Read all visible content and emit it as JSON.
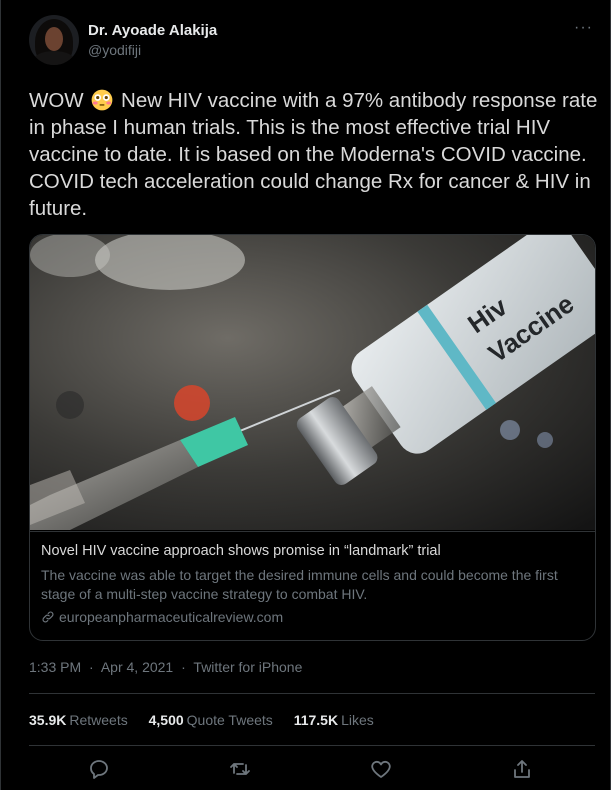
{
  "author": {
    "name": "Dr. Ayoade Alakija",
    "handle": "@yodifiji",
    "avatar_icon": "profile-photo"
  },
  "tweet": {
    "text_before_emoji": "WOW",
    "emoji": "flushed-face-emoji",
    "text_after_emoji": " New HIV vaccine with a 97% antibody response rate in phase I human trials. This is the most effective trial HIV vaccine to date. It is based on the Moderna's COVID vaccine. COVID tech acceleration could change Rx for cancer & HIV in future."
  },
  "card": {
    "image_label_line1": "Hiv",
    "image_label_line2": "Vaccine",
    "title": "Novel HIV vaccine approach shows promise in “landmark” trial",
    "description": "The vaccine was able to target the desired immune cells and could become the first stage of a multi-step vaccine strategy to combat HIV.",
    "domain": "europeanpharmaceuticalreview.com",
    "link_icon": "link-icon"
  },
  "meta": {
    "time": "1:33 PM",
    "separator": "·",
    "date": "Apr 4, 2021",
    "source": "Twitter for iPhone"
  },
  "stats": {
    "retweets_count": "35.9K",
    "retweets_label": "Retweets",
    "quotes_count": "4,500",
    "quotes_label": "Quote Tweets",
    "likes_count": "117.5K",
    "likes_label": "Likes"
  },
  "actions": {
    "reply_icon": "reply-icon",
    "retweet_icon": "retweet-icon",
    "like_icon": "heart-icon",
    "share_icon": "share-icon"
  },
  "colors": {
    "background": "#000000",
    "text": "#d9d9d9",
    "muted": "#6e767d",
    "border": "#2f3336",
    "vial_accent": "#5fb8c6",
    "needle_hub": "#3fc7a4"
  }
}
